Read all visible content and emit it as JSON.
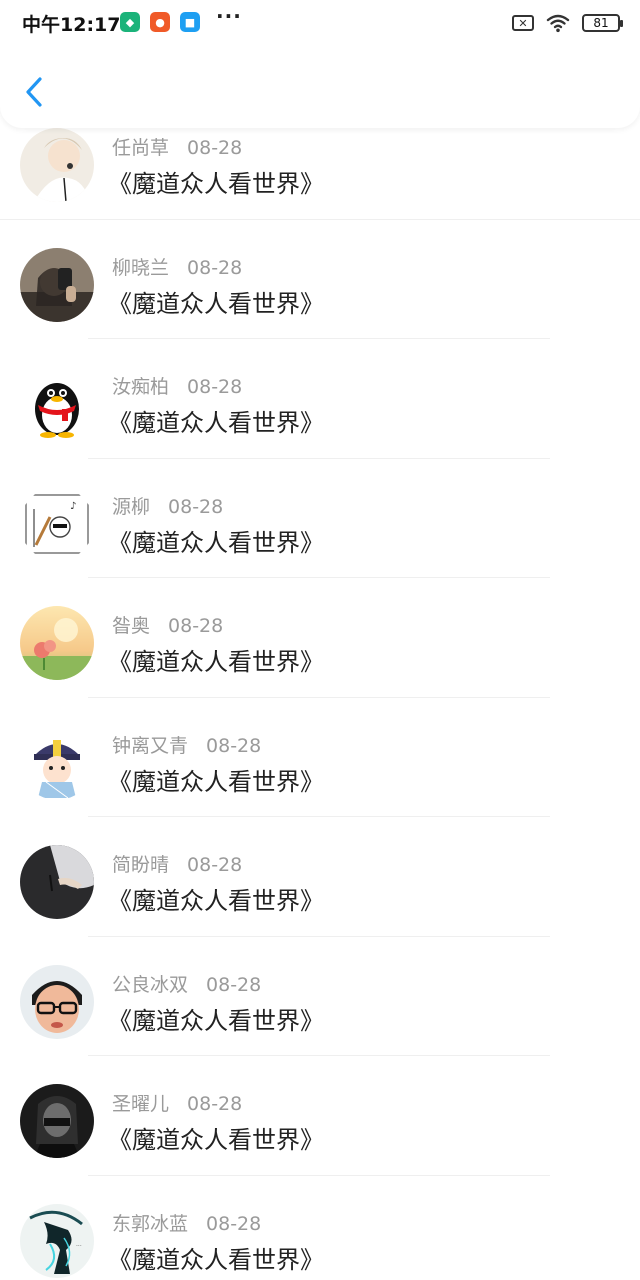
{
  "status_bar": {
    "time": "中午12:17",
    "battery": "81",
    "dots": "···"
  },
  "items": [
    {
      "name": "任尚草",
      "date": "08-28",
      "title": "《魔道众人看世界》",
      "avatar": "person-light-avatar"
    },
    {
      "name": "柳晓兰",
      "date": "08-28",
      "title": "《魔道众人看世界》",
      "avatar": "selfie-avatar"
    },
    {
      "name": "汝痴柏",
      "date": "08-28",
      "title": "《魔道众人看世界》",
      "avatar": "penguin-avatar"
    },
    {
      "name": "源柳",
      "date": "08-28",
      "title": "《魔道众人看世界》",
      "avatar": "sketch-avatar"
    },
    {
      "name": "昝奥",
      "date": "08-28",
      "title": "《魔道众人看世界》",
      "avatar": "flower-avatar"
    },
    {
      "name": "钟离又青",
      "date": "08-28",
      "title": "《魔道众人看世界》",
      "avatar": "jiangshi-avatar"
    },
    {
      "name": "简盼晴",
      "date": "08-28",
      "title": "《魔道众人看世界》",
      "avatar": "dark-hand-avatar"
    },
    {
      "name": "公良冰双",
      "date": "08-28",
      "title": "《魔道众人看世界》",
      "avatar": "glasses-person-avatar"
    },
    {
      "name": "圣曜儿",
      "date": "08-28",
      "title": "《魔道众人看世界》",
      "avatar": "masked-person-avatar"
    },
    {
      "name": "东郭冰蓝",
      "date": "08-28",
      "title": "《魔道众人看世界》",
      "avatar": "warrior-art-avatar"
    }
  ]
}
